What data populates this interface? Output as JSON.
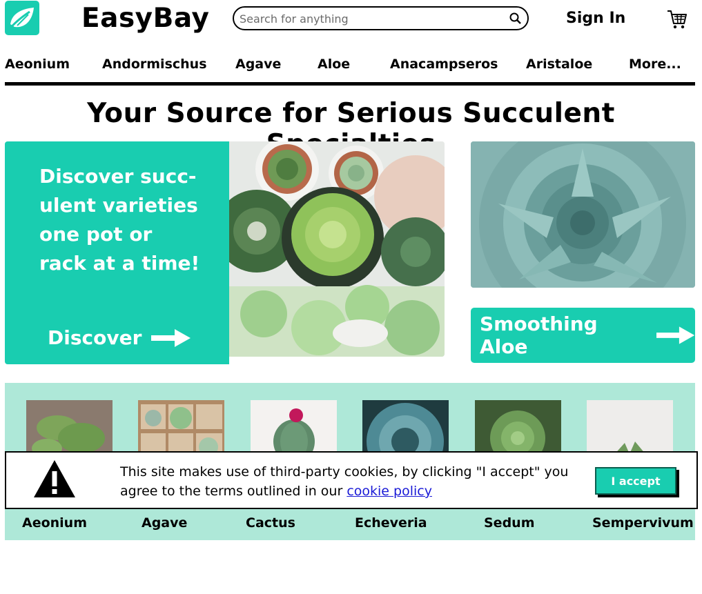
{
  "header": {
    "brand": "EasyBay",
    "search_placeholder": "Search for anything",
    "sign_in": "Sign In"
  },
  "nav": {
    "items": [
      "Aeonium",
      "Andormischus",
      "Agave",
      "Aloe",
      "Anacampseros",
      "Aristaloe",
      "More..."
    ]
  },
  "headline": "Your Source for Serious Succulent Specialties",
  "hero": {
    "text": "Discover succ- ulent varieties one pot or rack at a time!",
    "cta": "Discover",
    "side_cta": "Smoothing Aloe"
  },
  "categories": {
    "items": [
      "Aeonium",
      "Agave",
      "Cactus",
      "Echeveria",
      "Sedum",
      "Sempervivum"
    ]
  },
  "cookie": {
    "text_before": "This site makes use of third-party cookies, by clicking \"I accept\" you agree to the terms outlined in our",
    "link": "cookie policy",
    "accept": "I accept"
  },
  "colors": {
    "accent": "#19cdb0",
    "strip_bg": "#aee8d8",
    "link": "#1a1ad6"
  },
  "icons": [
    "leaf-logo-icon",
    "search-icon",
    "cart-icon",
    "arrow-right-icon",
    "warning-icon"
  ]
}
